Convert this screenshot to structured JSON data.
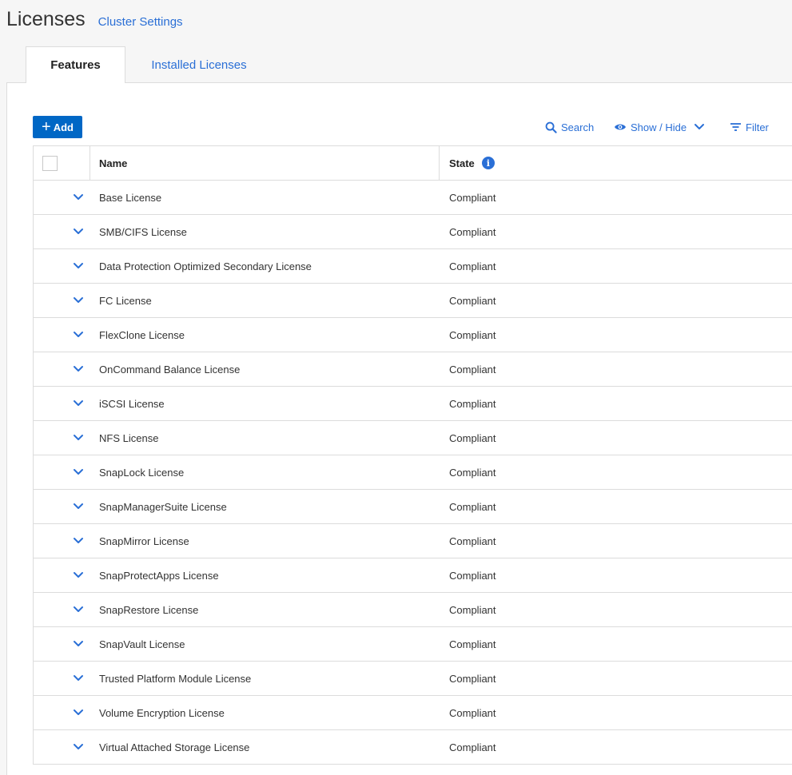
{
  "header": {
    "title": "Licenses",
    "cluster_link": "Cluster Settings"
  },
  "tabs": [
    {
      "label": "Features",
      "active": true
    },
    {
      "label": "Installed Licenses",
      "active": false
    }
  ],
  "toolbar": {
    "add_label": "Add",
    "search_label": "Search",
    "show_hide_label": "Show / Hide",
    "filter_label": "Filter"
  },
  "table": {
    "columns": [
      "Name",
      "State"
    ],
    "rows": [
      {
        "name": "Base License",
        "state": "Compliant"
      },
      {
        "name": "SMB/CIFS License",
        "state": "Compliant"
      },
      {
        "name": "Data Protection Optimized Secondary License",
        "state": "Compliant"
      },
      {
        "name": "FC License",
        "state": "Compliant"
      },
      {
        "name": "FlexClone License",
        "state": "Compliant"
      },
      {
        "name": "OnCommand Balance License",
        "state": "Compliant"
      },
      {
        "name": "iSCSI License",
        "state": "Compliant"
      },
      {
        "name": "NFS License",
        "state": "Compliant"
      },
      {
        "name": "SnapLock License",
        "state": "Compliant"
      },
      {
        "name": "SnapManagerSuite License",
        "state": "Compliant"
      },
      {
        "name": "SnapMirror License",
        "state": "Compliant"
      },
      {
        "name": "SnapProtectApps License",
        "state": "Compliant"
      },
      {
        "name": "SnapRestore License",
        "state": "Compliant"
      },
      {
        "name": "SnapVault License",
        "state": "Compliant"
      },
      {
        "name": "Trusted Platform Module License",
        "state": "Compliant"
      },
      {
        "name": "Volume Encryption License",
        "state": "Compliant"
      },
      {
        "name": "Virtual Attached Storage License",
        "state": "Compliant"
      }
    ]
  },
  "colors": {
    "accent": "#0067c5",
    "link": "#2a6fd6"
  }
}
